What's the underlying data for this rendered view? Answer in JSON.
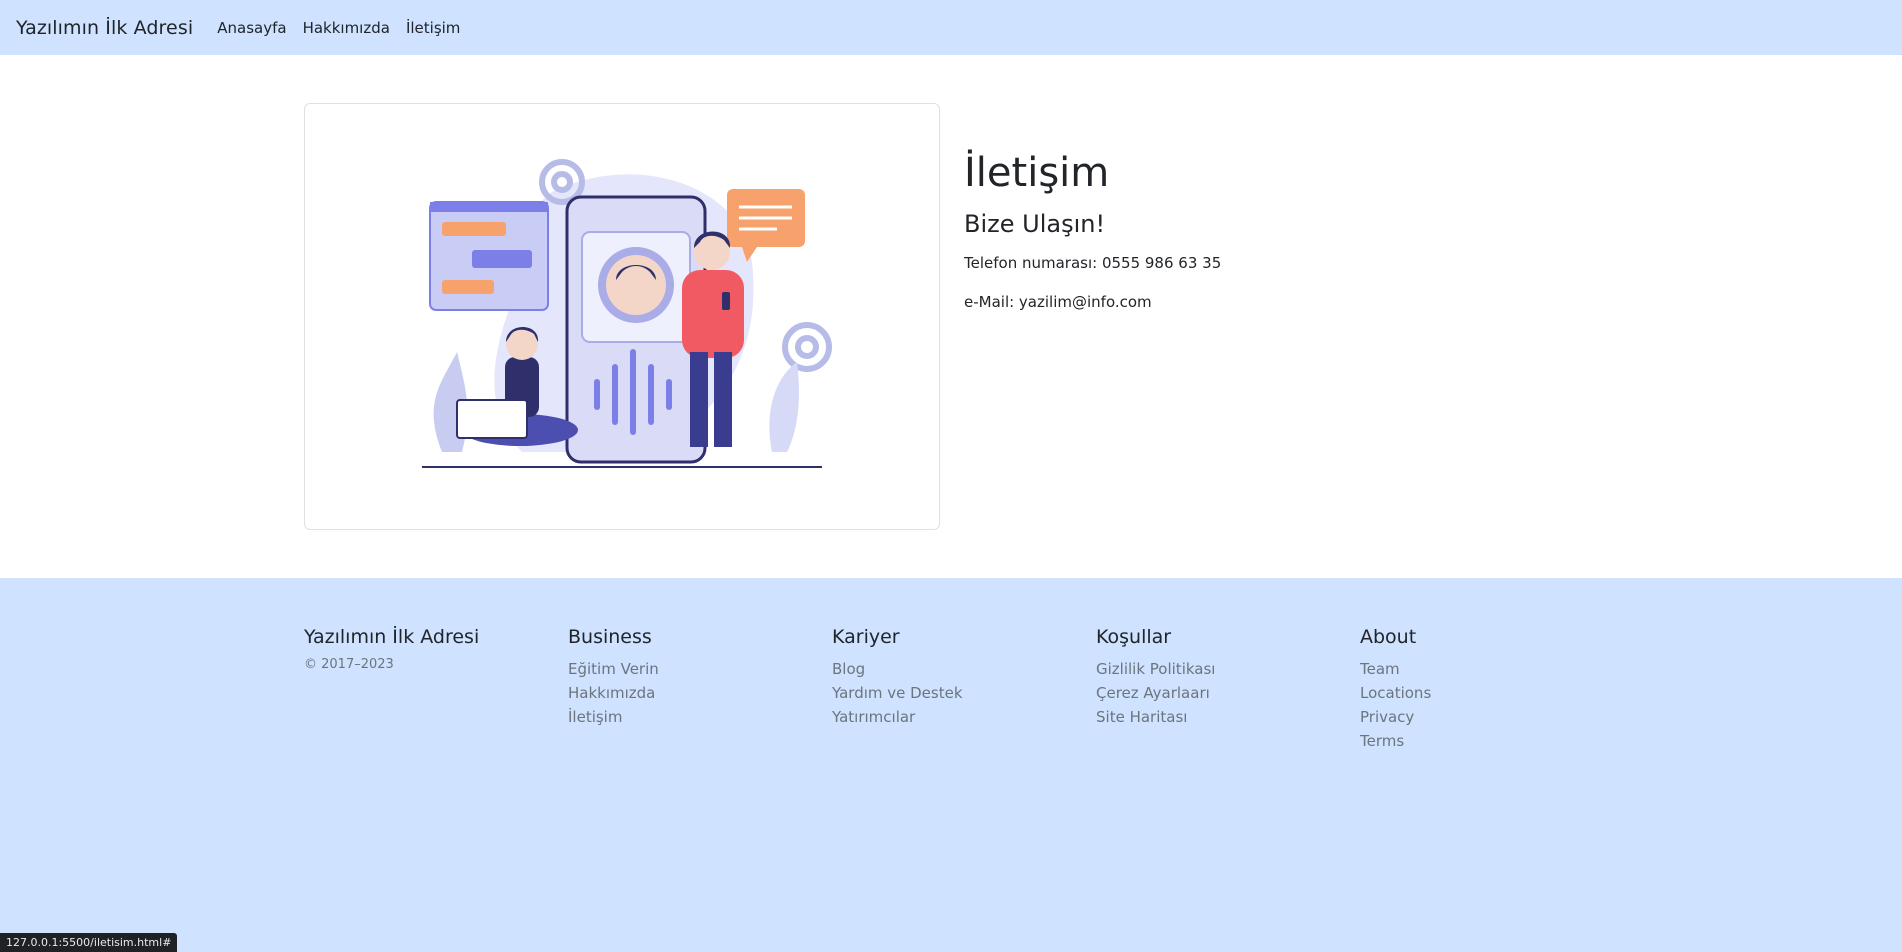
{
  "navbar": {
    "brand": "Yazılımın İlk Adresi",
    "links": [
      "Anasayfa",
      "Hakkımızda",
      "İletişim"
    ]
  },
  "contact": {
    "title": "İletişim",
    "subtitle": "Bize Ulaşın!",
    "phone": "Telefon numarası: 0555 986 63 35",
    "email": "e-Mail: yazilim@info.com"
  },
  "footer": {
    "brand": "Yazılımın İlk Adresi",
    "copyright": "© 2017–2023",
    "columns": [
      {
        "title": "Business",
        "links": [
          "Eğitim Verin",
          "Hakkımızda",
          "İletişim"
        ]
      },
      {
        "title": "Kariyer",
        "links": [
          "Blog",
          "Yardım ve Destek",
          "Yatırımcılar"
        ]
      },
      {
        "title": "Koşullar",
        "links": [
          "Gizlilik Politikası",
          "Çerez Ayarlaarı",
          "Site Haritası"
        ]
      },
      {
        "title": "About",
        "links": [
          "Team",
          "Locations",
          "Privacy",
          "Terms"
        ]
      }
    ]
  },
  "status_url": "127.0.0.1:5500/iletisim.html#",
  "colors": {
    "accent_bg": "#cfe2ff",
    "bubble_orange": "#f7a26c",
    "bubble_purple": "#7d7fe8",
    "shirt_red": "#f25a63"
  }
}
